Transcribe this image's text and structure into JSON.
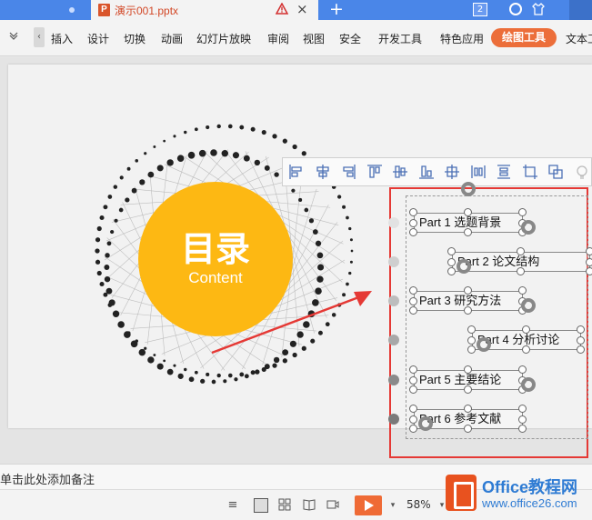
{
  "titlebar": {
    "document_title": "演示001.pptx",
    "ppt_icon": "P",
    "tab_count": "2",
    "add_tab": "+",
    "close_tab": "×"
  },
  "ribbon": {
    "menus": [
      "插入",
      "设计",
      "切换",
      "动画",
      "幻灯片放映",
      "审阅",
      "视图",
      "安全",
      "开发工具",
      "特色应用"
    ],
    "active_context_tab": "绘图工具",
    "next_tab": "文本工"
  },
  "slide": {
    "circle_title": "目录",
    "circle_subtitle": "Content",
    "accent_color": "#fdb813",
    "arrow_color": "#e53935",
    "items": [
      {
        "text": "Part 1  选题背景"
      },
      {
        "text": "Part 2  论文结构"
      },
      {
        "text": "Part 3  研究方法"
      },
      {
        "text": "Part 4  分析讨论"
      },
      {
        "text": "Part 5  主要结论"
      },
      {
        "text": "Part 6  参考文献"
      }
    ],
    "lead_dot_colors": [
      "#e2e2e2",
      "#cfcfcf",
      "#bdbdbd",
      "#a8a8a8",
      "#8a8a8a",
      "#7a7a7a"
    ]
  },
  "float_toolbar": {
    "icons": [
      "align-left-icon",
      "align-center-icon",
      "align-right-icon",
      "align-top-icon",
      "align-middle-icon",
      "align-bottom-icon",
      "distribute-grid-icon",
      "distribute-horizontal-icon",
      "distribute-vertical-icon",
      "crop-icon",
      "group-icon",
      "more-icon"
    ]
  },
  "notes": {
    "placeholder": "单击此处添加备注"
  },
  "status": {
    "zoom": "58%"
  },
  "watermark": {
    "line1": "Office教程网",
    "line2": "www.office26.com"
  }
}
